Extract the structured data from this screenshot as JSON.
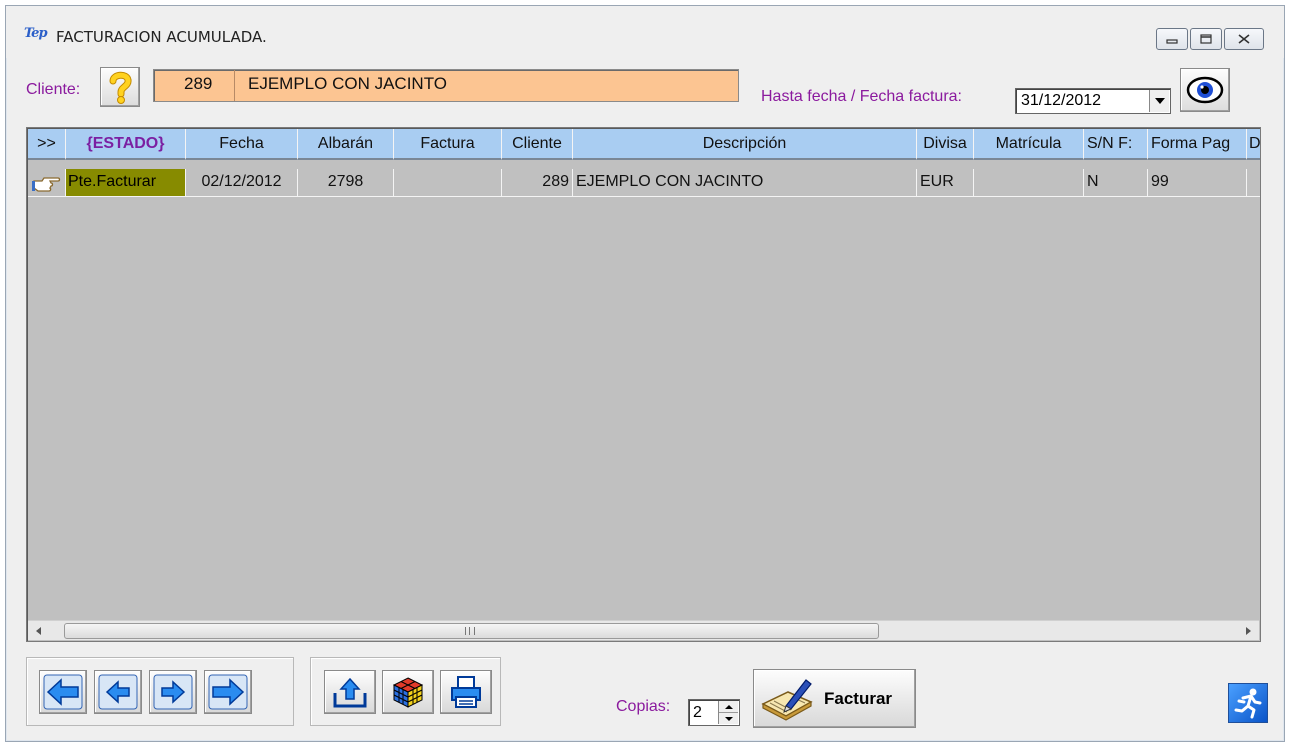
{
  "window": {
    "title": "FACTURACION ACUMULADA.",
    "app_icon_text": "Tep",
    "controls": [
      "minimize-icon",
      "maximize-icon",
      "close-icon"
    ]
  },
  "cliente": {
    "label": "Cliente:",
    "number": "289",
    "name": "EJEMPLO CON JACINTO",
    "help_icon": "question-mark-icon"
  },
  "fecha": {
    "label": "Hasta fecha / Fecha factura:",
    "value": "31/12/2012",
    "view_icon": "eye-icon"
  },
  "grid": {
    "columns": [
      ">>",
      "{ESTADO}",
      "Fecha",
      "Albarán",
      "Factura",
      "Cliente",
      "Descripción",
      "Divisa",
      "Matrícula",
      "S/N F:",
      "Forma Pag",
      "D"
    ],
    "rows": [
      {
        "pointer_icon": "pointing-hand-icon",
        "estado": "Pte.Facturar",
        "fecha": "02/12/2012",
        "albaran": "2798",
        "factura": "",
        "cliente": "289",
        "descripcion": "EJEMPLO CON JACINTO",
        "divisa": "EUR",
        "matricula": "",
        "sn": "N",
        "forma_pago": "99",
        "d": ""
      }
    ],
    "scroll_grip": "III"
  },
  "toolbar": {
    "nav_icons": [
      "first-arrow-icon",
      "prev-arrow-icon",
      "next-arrow-icon",
      "last-arrow-icon"
    ],
    "tool_icons": [
      "export-icon",
      "rubiks-cube-icon",
      "printer-icon"
    ]
  },
  "copias": {
    "label": "Copias:",
    "value": "2"
  },
  "facturar": {
    "label": "Facturar",
    "icon": "book-pen-icon"
  },
  "exit": {
    "icon": "running-man-exit-icon"
  },
  "colors": {
    "cliente_bg": "#fcc592",
    "header_bg": "#a9cdf2",
    "estado_bg": "#878b00",
    "label_purple": "#8b1a9e"
  }
}
